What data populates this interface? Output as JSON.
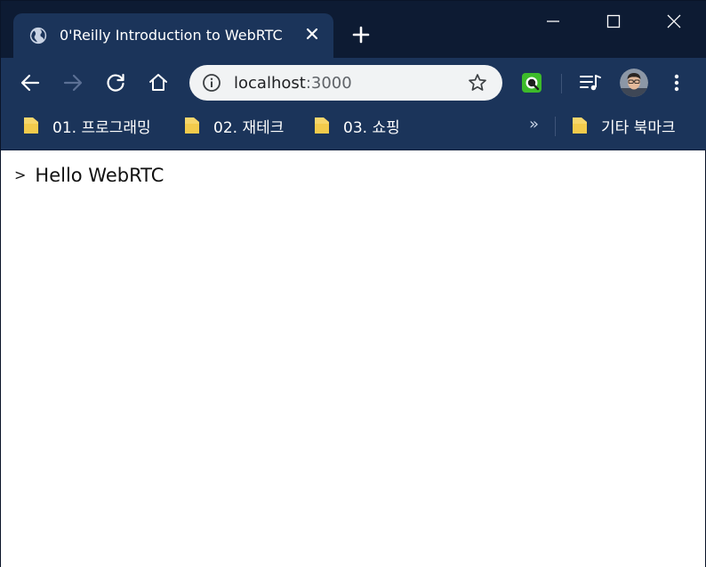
{
  "tab": {
    "title": "0'Reilly Introduction to WebRTC"
  },
  "address_bar": {
    "host": "localhost",
    "port": ":3000"
  },
  "bookmarks": {
    "items": [
      {
        "label": "01. 프로그래밍"
      },
      {
        "label": "02. 재테크"
      },
      {
        "label": "03. 쇼핑"
      }
    ],
    "overflow_label": "»",
    "other_label": "기타 북마크"
  },
  "page": {
    "prompt": ">",
    "message": "Hello WebRTC"
  },
  "colors": {
    "tab_strip": "#0d1b33",
    "toolbar": "#1b345a",
    "omnibox": "#f1f3f4",
    "folder": "#f6d66b",
    "content_bg": "#ffffff"
  },
  "icons": {
    "tab": "globe-icon",
    "back": "arrow-left-icon",
    "forward": "arrow-right-icon",
    "reload": "reload-icon",
    "home": "home-icon",
    "site_info": "info-icon",
    "bookmark_star": "star-icon",
    "extension": "extension-icon",
    "media": "media-control-icon",
    "menu": "kebab-menu-icon",
    "folder": "folder-icon"
  }
}
